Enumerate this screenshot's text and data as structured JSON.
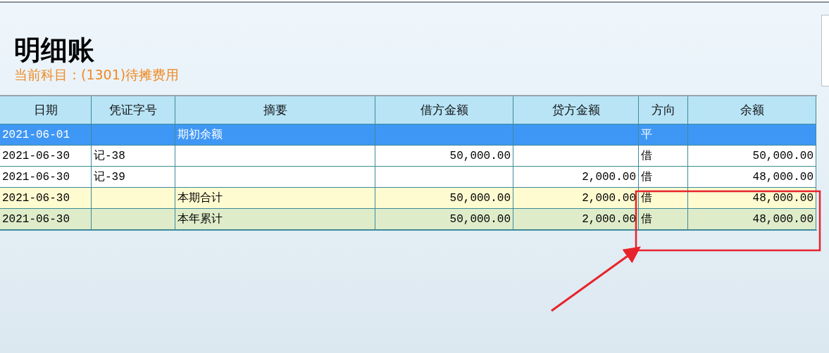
{
  "title": "明细账",
  "subtitle": "当前科目：(1301)待摊费用",
  "table": {
    "columns": [
      {
        "label": "日期",
        "kind": "text"
      },
      {
        "label": "凭证字号",
        "kind": "text"
      },
      {
        "label": "摘要",
        "kind": "text"
      },
      {
        "label": "借方金额",
        "kind": "amount"
      },
      {
        "label": "贷方金额",
        "kind": "amount"
      },
      {
        "label": "方向",
        "kind": "text"
      },
      {
        "label": "余额",
        "kind": "amount"
      }
    ],
    "rows": [
      {
        "selected": true,
        "cells": [
          "2021-06-01",
          "",
          "期初余额",
          "",
          "",
          "平",
          ""
        ]
      },
      {
        "kind": "entry",
        "selected": false,
        "cells": [
          "2021-06-30",
          "记-38",
          "",
          "50,000.00",
          "",
          "借",
          "50,000.00"
        ]
      },
      {
        "kind": "entry",
        "selected": false,
        "cells": [
          "2021-06-30",
          "记-39",
          "",
          "",
          "2,000.00",
          "借",
          "48,000.00"
        ]
      },
      {
        "kind": "period_total",
        "selected": false,
        "cells": [
          "2021-06-30",
          "",
          "本期合计",
          "50,000.00",
          "2,000.00",
          "借",
          "48,000.00"
        ]
      },
      {
        "kind": "year_total",
        "selected": false,
        "cells": [
          "2021-06-30",
          "",
          "本年累计",
          "50,000.00",
          "2,000.00",
          "借",
          "48,000.00"
        ]
      }
    ]
  }
}
